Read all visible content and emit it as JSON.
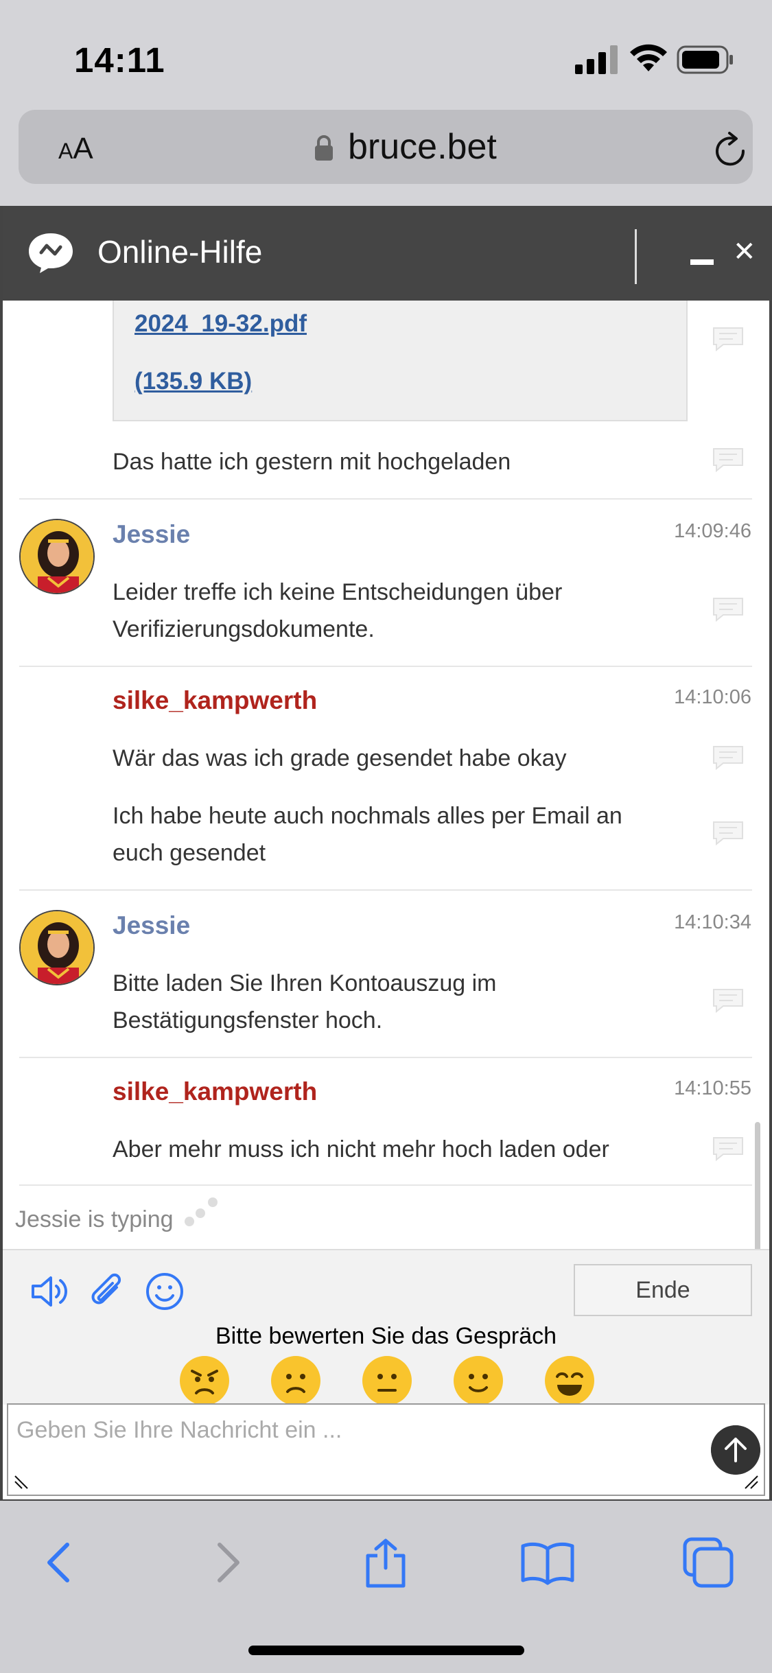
{
  "status_bar": {
    "time": "14:11",
    "icons": [
      "cellular-signal-icon",
      "wifi-icon",
      "battery-icon"
    ]
  },
  "browser": {
    "text_size_label_small": "A",
    "text_size_label_large": "A",
    "url": "bruce.bet",
    "icons": [
      "lock-icon",
      "reload-icon"
    ]
  },
  "chat": {
    "title": "Online-Hilfe",
    "file": {
      "name": "2024_19-32.pdf",
      "size": "(135.9 KB)"
    },
    "messages": [
      {
        "text": "Das hatte ich gestern mit hochgeladen"
      },
      {
        "author": "Jessie",
        "time": "14:09:46",
        "role": "agent",
        "lines": [
          "Leider treffe ich keine Entscheidungen über Verifizierungsdokumente."
        ]
      },
      {
        "author": "silke_kampwerth",
        "time": "14:10:06",
        "role": "user",
        "lines": [
          "Wär das was ich grade gesendet habe okay",
          "Ich habe heute auch nochmals alles per Email an euch gesendet"
        ]
      },
      {
        "author": "Jessie",
        "time": "14:10:34",
        "role": "agent",
        "lines": [
          "Bitte laden Sie Ihren Kontoauszug im Bestätigungsfenster hoch."
        ]
      },
      {
        "author": "silke_kampwerth",
        "time": "14:10:55",
        "role": "user",
        "lines": [
          "Aber mehr muss ich nicht mehr hoch laden oder"
        ]
      }
    ],
    "typing": "Jessie is typing",
    "end_button": "Ende",
    "rating_label": "Bitte bewerten Sie das Gespräch",
    "rating_options": [
      "angry-face-icon",
      "sad-face-icon",
      "neutral-face-icon",
      "smile-face-icon",
      "love-face-icon"
    ],
    "input_placeholder": "Geben Sie Ihre Nachricht ein ..."
  },
  "colors": {
    "header_bg": "#454545",
    "agent_name": "#6a80ad",
    "user_name": "#b0241d",
    "link": "#2f5d9e",
    "icon_blue": "#3478f6"
  }
}
